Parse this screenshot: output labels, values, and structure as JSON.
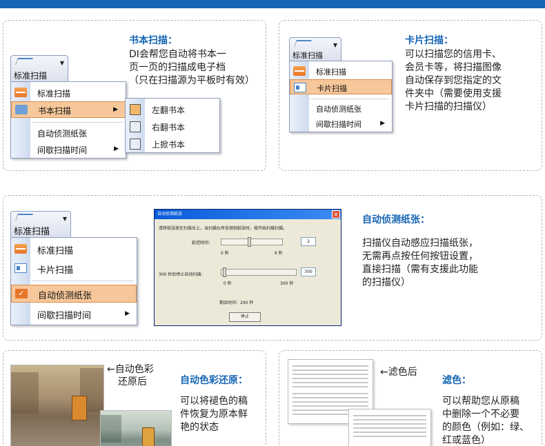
{
  "colors": {
    "accent": "#1565b4",
    "highlight": "#f6c79a",
    "menu_border": "#8d9dbb"
  },
  "book_scan": {
    "title": "书本扫描：",
    "desc": [
      "DI会帮您自动将书本一",
      "页一页的扫描成电子档",
      "（只在扫描源为平板时有效）"
    ],
    "menu_button": "标准扫描",
    "menu_items": [
      "标准扫描",
      "书本扫描",
      "自动侦测纸张",
      "间歇扫描时间"
    ],
    "submenu_items": [
      "左翻书本",
      "右翻书本",
      "上掀书本"
    ]
  },
  "card_scan": {
    "title": "卡片扫描：",
    "desc": [
      "可以扫描您的信用卡、",
      "会员卡等，将扫描图像",
      "自动保存到您指定的文",
      "件夹中（需要使用支援",
      "卡片扫描的扫描仪）"
    ],
    "menu_button": "标准扫描",
    "menu_items": [
      "标准扫描",
      "卡片扫描",
      "自动侦测纸张",
      "间歇扫描时间"
    ]
  },
  "auto_detect": {
    "title": "自动侦测纸张：",
    "desc": [
      "扫描仪自动感应扫描纸张，",
      "无需再点按任何按钮设置，",
      "直接扫描（需有支援此功能",
      "的扫描仪）"
    ],
    "menu_button": "标准扫描",
    "menu_items": [
      "标准扫描",
      "卡片扫描",
      "自动侦测纸张",
      "间歇扫描时间"
    ],
    "dialog": {
      "title": "自动侦测纸张",
      "close": "✕",
      "instruction": "请将纸张放在扫描台上，当扫描仪有侦测到纸张时，按开始扫描扫描。",
      "delay_label": "延迟时间：",
      "delay_value": "2",
      "delay_min": "0 秒",
      "delay_max": "6 秒",
      "wait_label": "300 秒后停止自动扫描：",
      "wait_value": "300",
      "wait_min": "0 秒",
      "wait_max": "300 秒",
      "remaining": "剩余时间：290 秒",
      "stop_button": "停止"
    }
  },
  "auto_color": {
    "title": "自动色彩还原：",
    "desc": [
      "可以将褪色的稿",
      "件恢复为原本鲜",
      "艳的状态"
    ],
    "caption": [
      "←自动色彩",
      "还原后"
    ]
  },
  "filter": {
    "title": "滤色：",
    "desc": [
      "可以帮助您从原稿",
      "中删除一个不必要",
      "的颜色（例如：绿、",
      "红或蓝色）"
    ],
    "caption": "←滤色后"
  }
}
